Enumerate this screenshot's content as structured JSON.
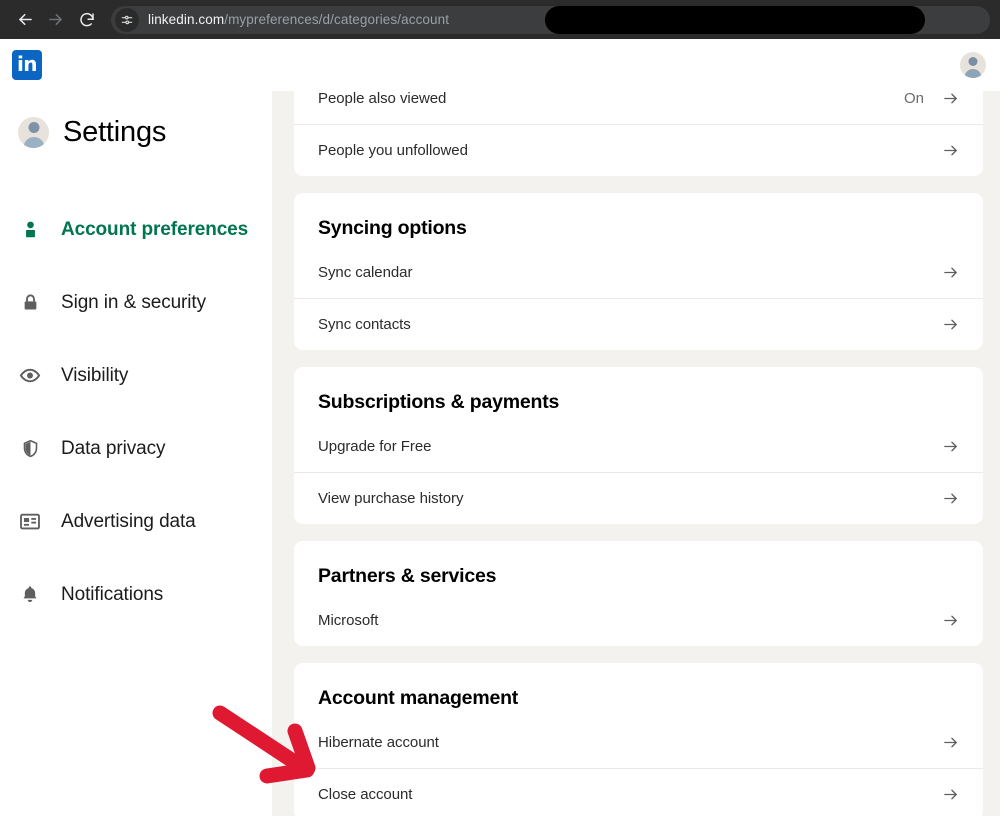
{
  "browser": {
    "back_icon": "arrow-left-icon",
    "forward_icon": "arrow-right-icon",
    "reload_icon": "reload-icon",
    "site_settings_icon": "tune-icon",
    "url_domain": "linkedin.com",
    "url_path": "/mypreferences/d/categories/account",
    "redaction_present": true
  },
  "header": {
    "logo_text": "in",
    "logo_color": "#0a66c2",
    "avatar_name": "user-avatar"
  },
  "sidebar": {
    "title": "Settings",
    "active_color": "#01754f",
    "items": [
      {
        "label": "Account preferences",
        "icon": "person-icon",
        "active": true
      },
      {
        "label": "Sign in & security",
        "icon": "lock-icon",
        "active": false
      },
      {
        "label": "Visibility",
        "icon": "eye-icon",
        "active": false
      },
      {
        "label": "Data privacy",
        "icon": "shield-icon",
        "active": false
      },
      {
        "label": "Advertising data",
        "icon": "id-card-icon",
        "active": false
      },
      {
        "label": "Notifications",
        "icon": "bell-icon",
        "active": false
      }
    ]
  },
  "main": {
    "cards": [
      {
        "title": null,
        "clipped_top": true,
        "rows": [
          {
            "label": "People also viewed",
            "value": "On",
            "arrow": "arrow-right-icon",
            "clipped": true
          },
          {
            "label": "People you unfollowed",
            "value": null,
            "arrow": "arrow-right-icon"
          }
        ]
      },
      {
        "title": "Syncing options",
        "rows": [
          {
            "label": "Sync calendar",
            "value": null,
            "arrow": "arrow-right-icon"
          },
          {
            "label": "Sync contacts",
            "value": null,
            "arrow": "arrow-right-icon"
          }
        ]
      },
      {
        "title": "Subscriptions & payments",
        "rows": [
          {
            "label": "Upgrade for Free",
            "value": null,
            "arrow": "arrow-right-icon"
          },
          {
            "label": "View purchase history",
            "value": null,
            "arrow": "arrow-right-icon"
          }
        ]
      },
      {
        "title": "Partners & services",
        "rows": [
          {
            "label": "Microsoft",
            "value": null,
            "arrow": "arrow-right-icon"
          }
        ]
      },
      {
        "title": "Account management",
        "rows": [
          {
            "label": "Hibernate account",
            "value": null,
            "arrow": "arrow-right-icon"
          },
          {
            "label": "Close account",
            "value": null,
            "arrow": "arrow-right-icon"
          }
        ]
      }
    ]
  },
  "annotation": {
    "type": "pointer-arrow",
    "color": "#e01933",
    "points_to": "Close account"
  }
}
